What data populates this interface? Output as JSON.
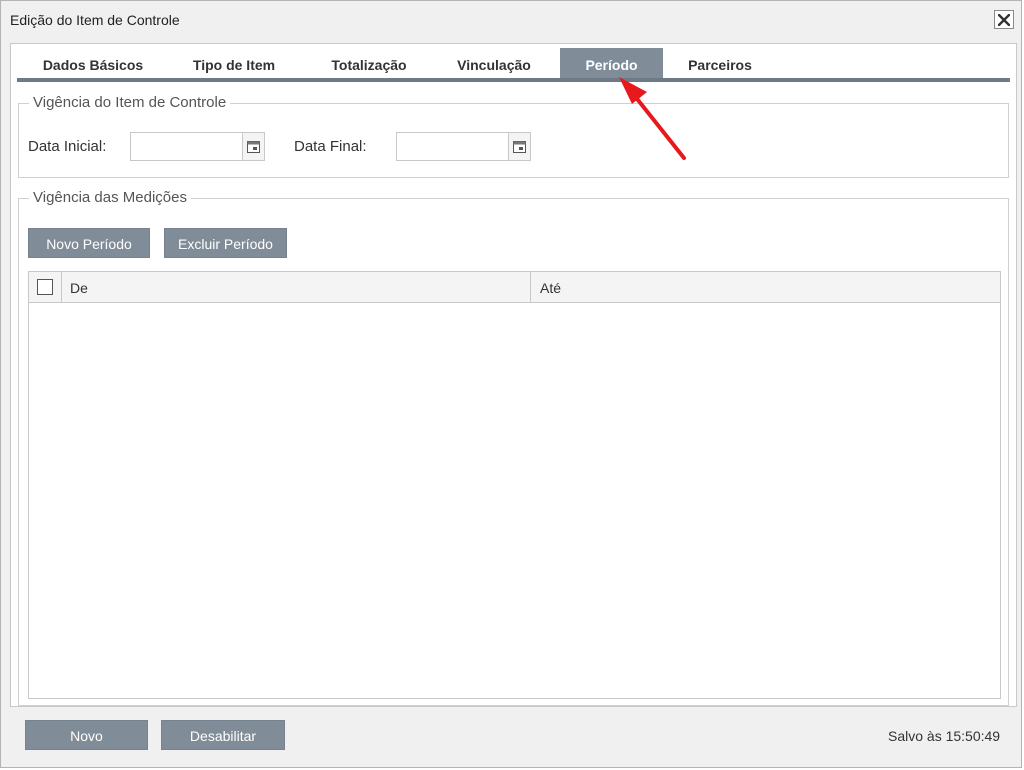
{
  "dialog": {
    "title": "Edição do Item de Controle",
    "close_icon": "close-icon"
  },
  "tabs": [
    {
      "label": "Dados Básicos",
      "active": false
    },
    {
      "label": "Tipo de Item",
      "active": false
    },
    {
      "label": "Totalização",
      "active": false
    },
    {
      "label": "Vinculação",
      "active": false
    },
    {
      "label": "Período",
      "active": true
    },
    {
      "label": "Parceiros",
      "active": false
    }
  ],
  "vigencia_item": {
    "legend": "Vigência do Item de Controle",
    "data_inicial_label": "Data Inicial:",
    "data_inicial_value": "",
    "data_final_label": "Data Final:",
    "data_final_value": "",
    "calendar_icon": "calendar-icon"
  },
  "vigencia_medicoes": {
    "legend": "Vigência das Medições",
    "novo_periodo_label": "Novo Período",
    "excluir_periodo_label": "Excluir Período",
    "grid": {
      "columns": [
        "De",
        "Até"
      ],
      "rows": []
    }
  },
  "footer": {
    "novo_label": "Novo",
    "desabilitar_label": "Desabilitar",
    "status": "Salvo às 15:50:49"
  },
  "colors": {
    "accent_button": "#808c98",
    "annotation_arrow": "#e8191c"
  }
}
